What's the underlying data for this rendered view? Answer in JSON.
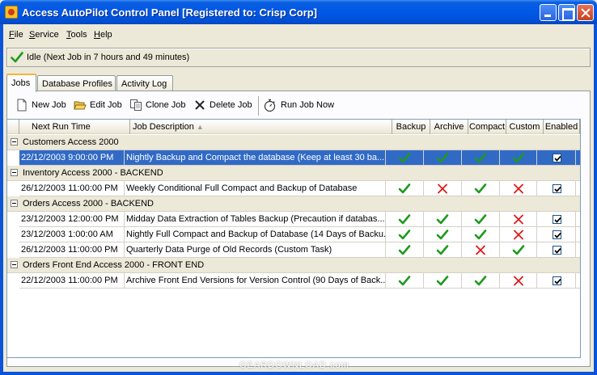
{
  "window": {
    "title": "Access AutoPilot Control Panel [Registered to: Crisp Corp]"
  },
  "menu": {
    "items": [
      {
        "key": "F",
        "rest": "ile"
      },
      {
        "key": "S",
        "rest": "ervice"
      },
      {
        "key": "T",
        "rest": "ools"
      },
      {
        "key": "H",
        "rest": "elp"
      }
    ]
  },
  "status": {
    "text": "Idle (Next Job in 7 hours and 49 minutes)",
    "icon": "check-icon"
  },
  "tabs": [
    {
      "label": "Jobs",
      "active": true
    },
    {
      "label": "Database Profiles",
      "active": false
    },
    {
      "label": "Activity Log",
      "active": false
    }
  ],
  "toolbar": {
    "new_job": "New Job",
    "edit_job": "Edit Job",
    "clone_job": "Clone Job",
    "delete_job": "Delete Job",
    "run_job_now": "Run Job Now"
  },
  "grid": {
    "columns": {
      "next_run_time": "Next Run Time",
      "job_description": "Job Description",
      "backup": "Backup",
      "archive": "Archive",
      "compact": "Compact",
      "custom": "Custom",
      "enabled": "Enabled"
    },
    "groups": [
      {
        "name": "Customers Access 2000",
        "jobs": [
          {
            "time": "22/12/2003 9:00:00 PM",
            "description": "Nightly Backup and Compact the database (Keep at least 30 ba...",
            "backup": true,
            "archive": true,
            "compact": true,
            "custom": true,
            "enabled": true,
            "selected": true
          }
        ]
      },
      {
        "name": "Inventory Access 2000 - BACKEND",
        "jobs": [
          {
            "time": "26/12/2003 11:00:00 PM",
            "description": "Weekly Conditional Full Compact and Backup of Database",
            "backup": true,
            "archive": false,
            "compact": true,
            "custom": false,
            "enabled": true,
            "selected": false
          }
        ]
      },
      {
        "name": "Orders Access 2000 - BACKEND",
        "jobs": [
          {
            "time": "23/12/2003 12:00:00 PM",
            "description": "Midday Data Extraction of Tables Backup (Precaution if databas...",
            "backup": true,
            "archive": true,
            "compact": true,
            "custom": false,
            "enabled": true,
            "selected": false
          },
          {
            "time": "23/12/2003 1:00:00 AM",
            "description": "Nightly Full Compact and Backup of Database (14 Days of Backu...",
            "backup": true,
            "archive": true,
            "compact": true,
            "custom": false,
            "enabled": true,
            "selected": false
          },
          {
            "time": "26/12/2003 11:00:00 PM",
            "description": "Quarterly Data Purge of Old Records (Custom Task)",
            "backup": true,
            "archive": true,
            "compact": false,
            "custom": true,
            "enabled": true,
            "selected": false
          }
        ]
      },
      {
        "name": "Orders Front End Access 2000 - FRONT END",
        "jobs": [
          {
            "time": "22/12/2003 11:00:00 PM",
            "description": "Archive Front End Versions for Version Control (90 Days of Back...",
            "backup": true,
            "archive": true,
            "compact": true,
            "custom": false,
            "enabled": true,
            "selected": false
          }
        ]
      }
    ]
  },
  "colors": {
    "check_green": "#1e9a1e",
    "cross_red": "#e01818",
    "selection_blue": "#316ac5"
  },
  "watermark": "GEARDOWNLOAD.com"
}
